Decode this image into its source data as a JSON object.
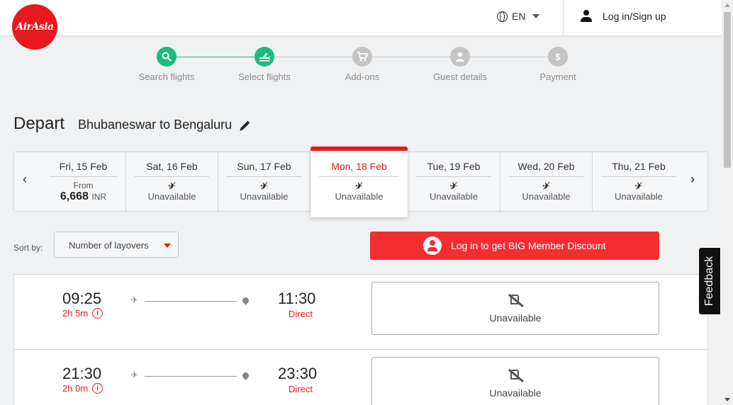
{
  "header": {
    "logo_text": "AirAsia",
    "language": "EN",
    "login_label": "Log in/Sign up"
  },
  "stepper": {
    "steps": [
      {
        "label": "Search flights",
        "icon": "search-icon",
        "active": true
      },
      {
        "label": "Select flights",
        "icon": "plane-icon",
        "active": true
      },
      {
        "label": "Add-ons",
        "icon": "cart-icon",
        "active": false
      },
      {
        "label": "Guest details",
        "icon": "person-icon",
        "active": false
      },
      {
        "label": "Payment",
        "icon": "dollar-icon",
        "active": false
      }
    ]
  },
  "title": {
    "depart": "Depart",
    "route": "Bhubaneswar to Bengaluru"
  },
  "dates": [
    {
      "label": "Fri, 15 Feb",
      "from": "From",
      "price": "6,668",
      "currency": "INR",
      "selected": false
    },
    {
      "label": "Sat, 16 Feb",
      "status": "Unavailable",
      "selected": false
    },
    {
      "label": "Sun, 17 Feb",
      "status": "Unavailable",
      "selected": false
    },
    {
      "label": "Mon, 18 Feb",
      "status": "Unavailable",
      "selected": true
    },
    {
      "label": "Tue, 19 Feb",
      "status": "Unavailable",
      "selected": false
    },
    {
      "label": "Wed, 20 Feb",
      "status": "Unavailable",
      "selected": false
    },
    {
      "label": "Thu, 21 Feb",
      "status": "Unavailable",
      "selected": false
    }
  ],
  "sort": {
    "label": "Sort by:",
    "value": "Number of layovers"
  },
  "discount_button": "Log in to get BIG Member Discount",
  "feedback_label": "Feedback",
  "flights": [
    {
      "depart": "09:25",
      "duration": "2h 5m",
      "arrive": "11:30",
      "stops": "Direct",
      "fare": "Unavailable"
    },
    {
      "depart": "21:30",
      "duration": "2h 0m",
      "arrive": "23:30",
      "stops": "Direct",
      "fare": "Unavailable"
    }
  ],
  "colors": {
    "brand_red": "#e8191f",
    "step_green": "#1dbb7a"
  }
}
